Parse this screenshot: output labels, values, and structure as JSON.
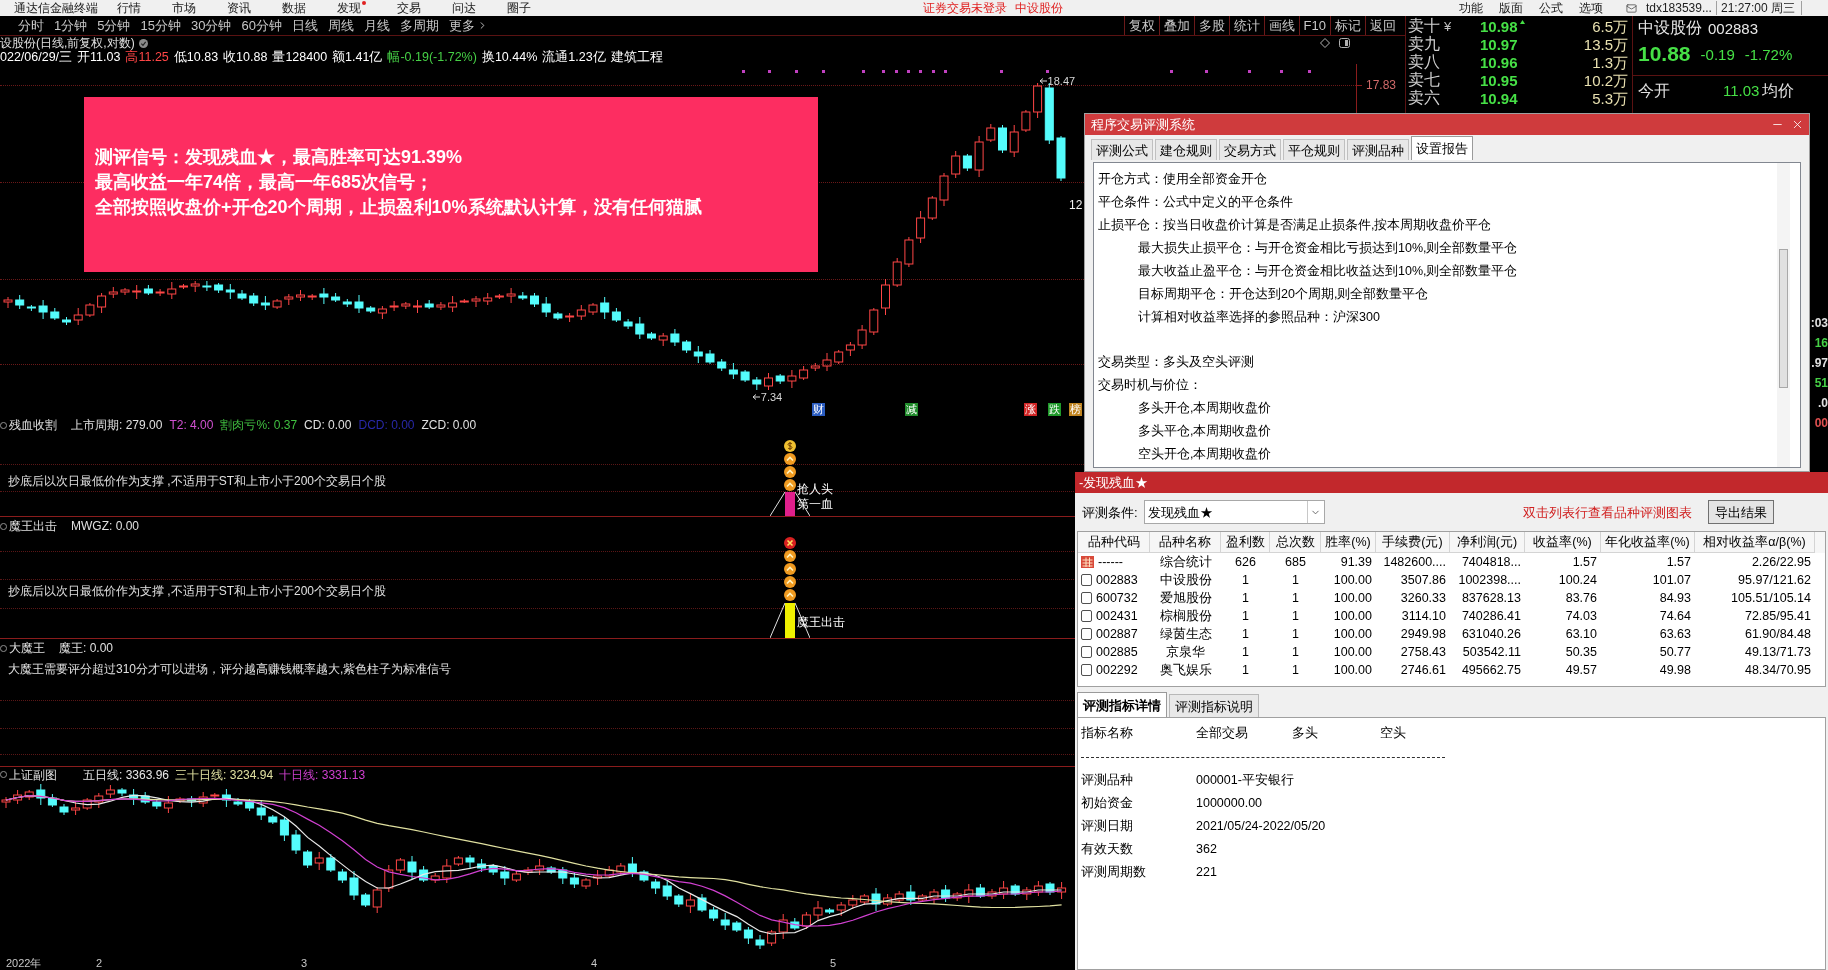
{
  "menu_bar": {
    "app_title": "通达信金融终端",
    "items": [
      {
        "label": "行情",
        "badge": false
      },
      {
        "label": "市场",
        "badge": false
      },
      {
        "label": "资讯",
        "badge": false
      },
      {
        "label": "数据",
        "badge": false
      },
      {
        "label": "发现",
        "badge": true
      },
      {
        "label": "交易",
        "badge": false
      },
      {
        "label": "问达",
        "badge": false
      },
      {
        "label": "圈子",
        "badge": false
      }
    ],
    "notices": [
      "证券交易未登录",
      "中设股份"
    ],
    "right_items": [
      "功能",
      "版面",
      "公式",
      "选项"
    ],
    "account": "tdx183539...",
    "clock": "21:27:00 周三"
  },
  "period_bar": {
    "periods": [
      "分时",
      "1分钟",
      "5分钟",
      "15分钟",
      "30分钟",
      "60分钟",
      "日线",
      "周线",
      "月线",
      "多周期"
    ],
    "more": "更多",
    "tools": [
      "复权",
      "叠加",
      "多股",
      "统计",
      "画线",
      "F10",
      "标记",
      "返回"
    ]
  },
  "chart_header": {
    "title": "设股份(日线,前复权,对数)",
    "quote": [
      {
        "text": "022/06/29/三",
        "color": "#ffffff"
      },
      {
        "text": "开11.03",
        "color": "#ffffff"
      },
      {
        "text": "高11.25",
        "color": "#ff4646"
      },
      {
        "text": "低10.83",
        "color": "#ffffff"
      },
      {
        "text": "收10.88",
        "color": "#ffffff"
      },
      {
        "text": "量128400",
        "color": "#ffffff"
      },
      {
        "text": "额1.41亿",
        "color": "#ffffff"
      },
      {
        "text": "幅-0.19(-1.72%)",
        "color": "#46d046"
      },
      {
        "text": "换10.44%",
        "color": "#ffffff"
      },
      {
        "text": "流通1.23亿",
        "color": "#ffffff"
      },
      {
        "text": "建筑工程",
        "color": "#ffffff"
      }
    ]
  },
  "main_chart": {
    "banner": [
      "测评信号：发现残血★，最高胜率可达91.39%",
      "最高收益一年74倍，最高一年685次信号；",
      "全部按照收盘价+开仓20个周期，止损盈利10%系统默认计算，没有任何猫腻"
    ],
    "high_label": "18.47",
    "low_label": "7.34",
    "price_axis": "17.83",
    "side_label": "12",
    "event_tags": [
      {
        "text": "财",
        "color": "#2a5cc0"
      },
      {
        "text": "减",
        "color": "#1f8a2a"
      },
      {
        "text": "涨",
        "color": "#d02424"
      },
      {
        "text": "跌",
        "color": "#1f9a2a"
      },
      {
        "text": "榜",
        "color": "#c08420"
      }
    ]
  },
  "indicators": [
    {
      "title": "残血收割",
      "values": [
        {
          "text": "上市周期: 279.00",
          "color": "#e0e0e0"
        },
        {
          "text": "T2: 4.00",
          "color": "#d050d0"
        },
        {
          "text": "割肉亏%: 0.37",
          "color": "#40c040"
        },
        {
          "text": "CD: 0.00",
          "color": "#e0e0e0"
        },
        {
          "text": "DCD: 0.00",
          "color": "#2828a8"
        },
        {
          "text": "ZCD: 0.00",
          "color": "#e0e0e0"
        }
      ],
      "note": "抄底后以次日最低价作为支撑 ,不适用于ST和上市小于200个交易日个股",
      "signal": {
        "kind": "coin",
        "color": "#e0208c",
        "labels": [
          "抢人头",
          "第一血"
        ]
      }
    },
    {
      "title": "魔王出击",
      "values": [
        {
          "text": "MWGZ: 0.00",
          "color": "#e0e0e0"
        }
      ],
      "note": "抄底后以次日最低价作为支撑 ,不适用于ST和上市小于200个交易日个股",
      "signal": {
        "kind": "cross",
        "color": "#f0f000",
        "labels": [
          "魔王出击"
        ]
      }
    },
    {
      "title": "大魔王",
      "values": [
        {
          "text": "魔王: 0.00",
          "color": "#e0e0e0"
        }
      ],
      "note": "大魔王需要评分超过310分才可以进场，评分越高赚钱概率越大,紫色柱子为标准信号"
    }
  ],
  "index_chart": {
    "title": "上证副图",
    "values": [
      {
        "text": "五日线: 3363.96",
        "color": "#e8e8e8"
      },
      {
        "text": "三十日线: 3234.94",
        "color": "#e0e0a0"
      },
      {
        "text": "十日线: 3331.13",
        "color": "#d040d0"
      }
    ],
    "date_labels": [
      "2022年",
      "2",
      "3",
      "4",
      "5"
    ]
  },
  "order_book": [
    {
      "label": "卖十",
      "tag": "¥",
      "price": "10.98",
      "uptick": true,
      "volume": "6.5万"
    },
    {
      "label": "卖九",
      "price": "10.97",
      "uptick": false,
      "volume": "13.5万"
    },
    {
      "label": "卖八",
      "price": "10.96",
      "uptick": false,
      "volume": "1.3万"
    },
    {
      "label": "卖七",
      "price": "10.95",
      "uptick": false,
      "volume": "10.2万"
    },
    {
      "label": "卖六",
      "price": "10.94",
      "uptick": false,
      "volume": "5.3万"
    }
  ],
  "stock_quote": {
    "name": "中设股份",
    "code": "002883",
    "price": "10.88",
    "change": "-0.19",
    "change_pct": "-1.72%",
    "open_label": "今开",
    "open": "11.03",
    "avg_label": "均价"
  },
  "edge_fragments": [
    {
      "text": ":03",
      "color": "#e0e0e0"
    },
    {
      "text": "16",
      "color": "#46d046"
    },
    {
      "text": ".97",
      "color": "#e0e0e0"
    },
    {
      "text": "51",
      "color": "#46d046"
    },
    {
      "text": ".0",
      "color": "#e0e0e0"
    },
    {
      "text": "00",
      "color": "#e05050"
    }
  ],
  "settings_dialog": {
    "title": "程序交易评测系统",
    "tabs": [
      {
        "label": "评测公式",
        "selected": false
      },
      {
        "label": "建仓规则",
        "selected": false
      },
      {
        "label": "交易方式",
        "selected": false
      },
      {
        "label": "平仓规则",
        "selected": false
      },
      {
        "label": "评测品种",
        "selected": false
      },
      {
        "label": "设置报告",
        "selected": true
      }
    ],
    "report_sections": [
      {
        "lines": [
          {
            "text": "开仓方式：使用全部资金开仓"
          },
          {
            "text": "平仓条件：公式中定义的平仓条件"
          },
          {
            "text": "止损平仓：按当日收盘价计算是否满足止损条件,按本周期收盘价平仓",
            "children": [
              {
                "text": "最大损失止损平仓：与开仓资金相比亏损达到10%,则全部数量平仓"
              },
              {
                "text": "最大收益止盈平仓：与开仓资金相比收益达到10%,则全部数量平仓"
              },
              {
                "text": "目标周期平仓：开仓达到20个周期,则全部数量平仓"
              },
              {
                "text": "计算相对收益率选择的参照品种：沪深300"
              }
            ]
          }
        ]
      },
      {
        "lines": [
          {
            "text": "交易类型：多头及空头评测"
          },
          {
            "text": "交易时机与价位：",
            "children": [
              {
                "text": "多头开仓,本周期收盘价"
              },
              {
                "text": "多头平仓,本周期收盘价"
              },
              {
                "text": "空头开仓,本周期收盘价"
              }
            ]
          }
        ]
      }
    ]
  },
  "results_dialog": {
    "title": "-发现残血★",
    "condition_label": "评测条件:",
    "condition_value": "发现残血★",
    "hint": "双击列表行查看品种评测图表",
    "export_button": "导出结果",
    "columns": [
      "品种代码",
      "品种名称",
      "盈利数",
      "总次数",
      "胜率(%)",
      "手续费(元)",
      "净利润(元)",
      "收益率(%)",
      "年化收益率(%)",
      "相对收益率α/β(%)"
    ],
    "rows": [
      {
        "kind": "summary",
        "cells": [
          "------",
          "综合统计",
          "626",
          "685",
          "91.39",
          "1482600....",
          "7404818...",
          "1.57",
          "1.57",
          "2.26/22.95"
        ]
      },
      {
        "kind": "stock",
        "checked": false,
        "cells": [
          "002883",
          "中设股份",
          "1",
          "1",
          "100.00",
          "3507.86",
          "1002398....",
          "100.24",
          "101.07",
          "95.97/121.62"
        ]
      },
      {
        "kind": "stock",
        "checked": false,
        "cells": [
          "600732",
          "爱旭股份",
          "1",
          "1",
          "100.00",
          "3260.33",
          "837628.13",
          "83.76",
          "84.93",
          "105.51/105.14"
        ]
      },
      {
        "kind": "stock",
        "checked": false,
        "cells": [
          "002431",
          "棕榈股份",
          "1",
          "1",
          "100.00",
          "3114.10",
          "740286.41",
          "74.03",
          "74.64",
          "72.85/95.41"
        ]
      },
      {
        "kind": "stock",
        "checked": false,
        "cells": [
          "002887",
          "绿茵生态",
          "1",
          "1",
          "100.00",
          "2949.98",
          "631040.26",
          "63.10",
          "63.63",
          "61.90/84.48"
        ]
      },
      {
        "kind": "stock",
        "checked": false,
        "cells": [
          "002885",
          "京泉华",
          "1",
          "1",
          "100.00",
          "2758.43",
          "503542.11",
          "50.35",
          "50.77",
          "49.13/71.73"
        ]
      },
      {
        "kind": "stock",
        "checked": false,
        "cells": [
          "002292",
          "奥飞娱乐",
          "1",
          "1",
          "100.00",
          "2746.61",
          "495662.75",
          "49.57",
          "49.98",
          "48.34/70.95"
        ]
      }
    ],
    "detail_tabs": [
      {
        "label": "评测指标详情",
        "selected": true
      },
      {
        "label": "评测指标说明",
        "selected": false
      }
    ],
    "detail_header": [
      "指标名称",
      "全部交易",
      "多头",
      "空头"
    ],
    "details": [
      {
        "label": "评测品种",
        "value": "000001-平安银行"
      },
      {
        "label": "初始资金",
        "value": "1000000.00"
      },
      {
        "label": "评测日期",
        "value": "2021/05/24-2022/05/20"
      },
      {
        "label": "有效天数",
        "value": "362"
      },
      {
        "label": "评测周期数",
        "value": "221"
      }
    ]
  }
}
